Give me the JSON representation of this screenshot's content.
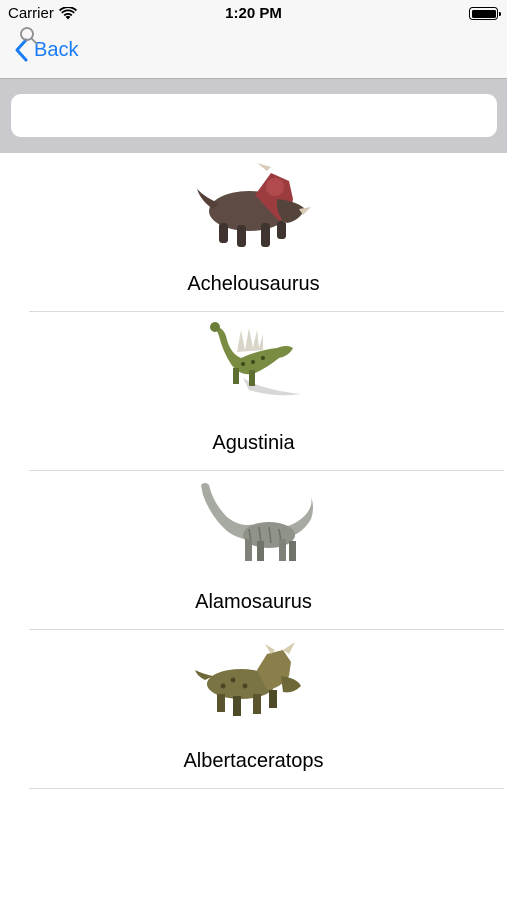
{
  "status_bar": {
    "carrier": "Carrier",
    "time": "1:20 PM",
    "icons": [
      "wifi-icon",
      "battery-icon"
    ]
  },
  "nav": {
    "back_label": "Back",
    "back_icon": "chevron-left-icon",
    "tint_color": "#1a7cf5"
  },
  "search": {
    "value": "",
    "placeholder": "",
    "icon": "search-icon"
  },
  "dinosaurs": [
    {
      "name": "Achelousaurus",
      "image": "triceratops-like-dinosaur-image"
    },
    {
      "name": "Agustinia",
      "image": "spiked-sauropod-dinosaur-image"
    },
    {
      "name": "Alamosaurus",
      "image": "long-neck-sauropod-dinosaur-image"
    },
    {
      "name": "Albertaceratops",
      "image": "horned-ceratopsian-dinosaur-image"
    }
  ]
}
